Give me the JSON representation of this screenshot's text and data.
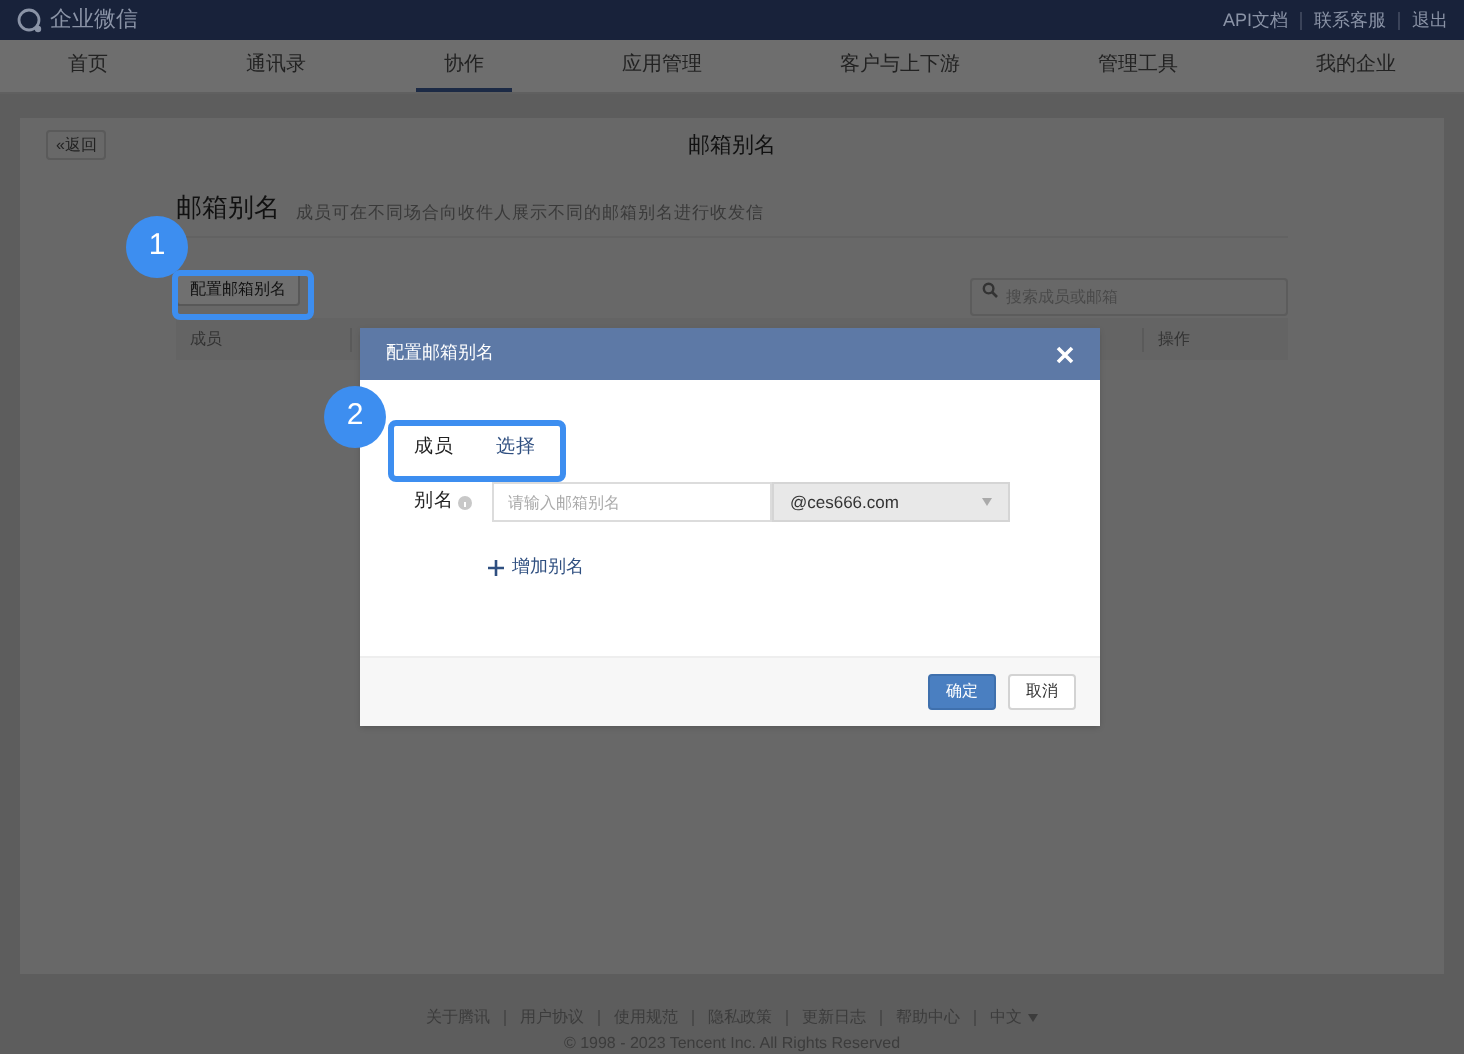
{
  "top_bar": {
    "logo": "企业微信",
    "links": [
      "API文档",
      "联系客服",
      "退出"
    ]
  },
  "nav_tabs": [
    {
      "label": "首页",
      "selected": false
    },
    {
      "label": "通讯录",
      "selected": false
    },
    {
      "label": "协作",
      "selected": true
    },
    {
      "label": "应用管理",
      "selected": false
    },
    {
      "label": "客户与上下游",
      "selected": false
    },
    {
      "label": "管理工具",
      "selected": false
    },
    {
      "label": "我的企业",
      "selected": false
    }
  ],
  "page": {
    "back_button": "«返回",
    "title": "邮箱别名",
    "section_title": "邮箱别名",
    "description": "成员可在不同场合向收件人展示不同的邮箱别名进行收发信",
    "config_button": "配置邮箱别名",
    "search": {
      "placeholder": "搜索成员或邮箱"
    },
    "table": {
      "columns": [
        "成员",
        "操作"
      ]
    }
  },
  "dialog": {
    "title": "配置邮箱别名",
    "member_label": "成员",
    "select_link": "选择",
    "alias_label": "别名",
    "alias_input": {
      "placeholder": "请输入邮箱别名"
    },
    "domain_select": {
      "value": "@ces666.com"
    },
    "add_alias": "增加别名",
    "buttons": [
      {
        "label": "确定",
        "kind": "primary"
      },
      {
        "label": "取消",
        "kind": "secondary"
      }
    ]
  },
  "annotations": [
    {
      "number": "1"
    },
    {
      "number": "2"
    }
  ],
  "footer": {
    "links": [
      "关于腾讯",
      "用户协议",
      "使用规范",
      "隐私政策",
      "更新日志",
      "帮助中心"
    ],
    "language": "中文",
    "copyright": "© 1998 - 2023 Tencent Inc. All Rights Reserved"
  }
}
